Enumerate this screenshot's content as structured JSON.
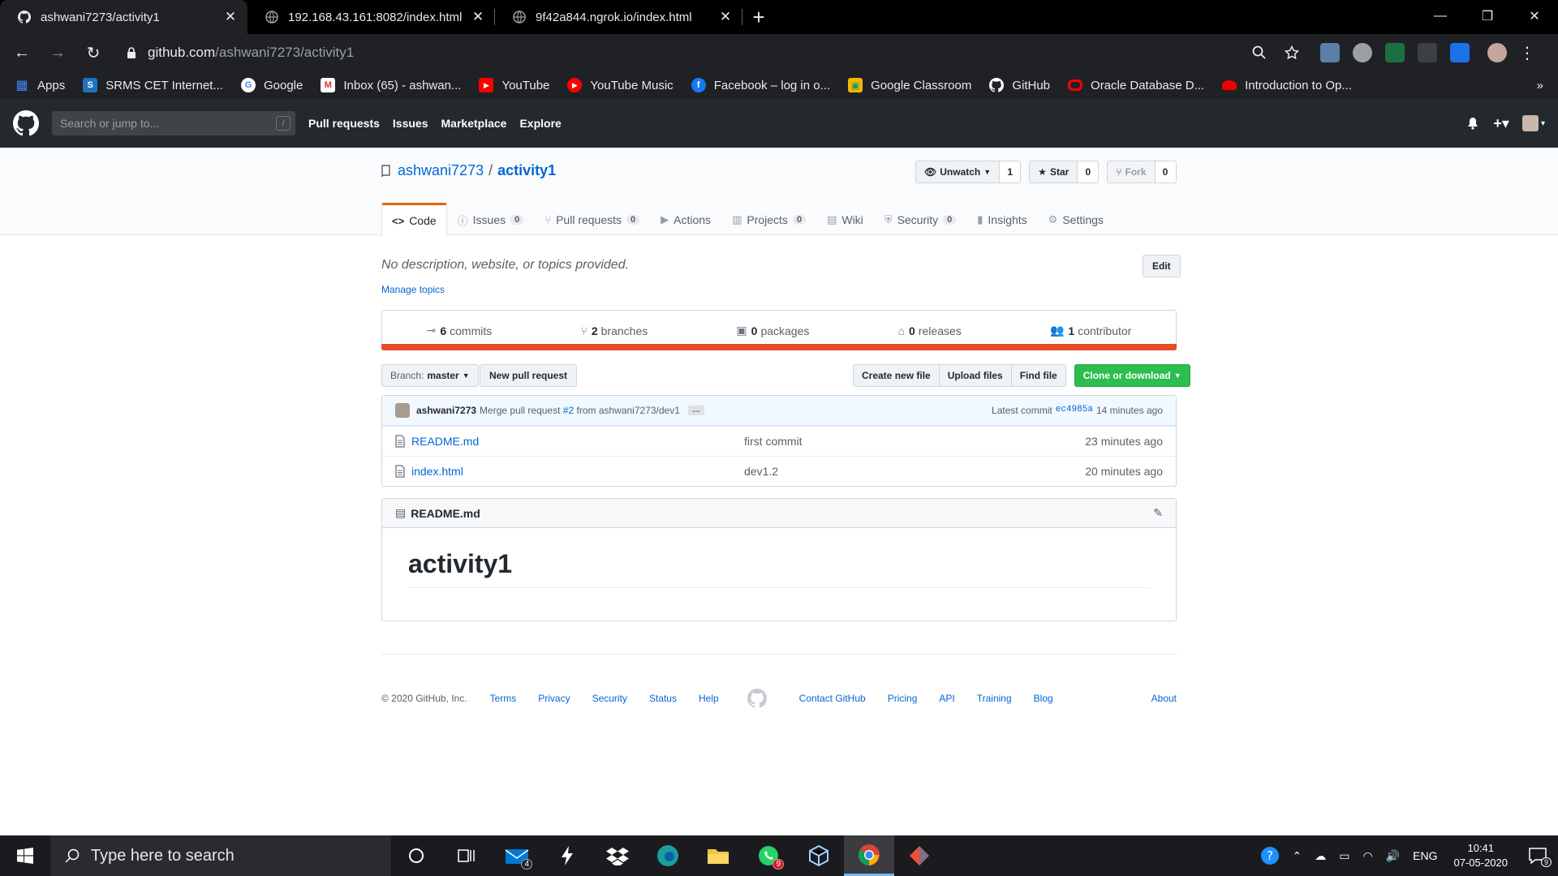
{
  "browser": {
    "tabs": [
      {
        "title": "ashwani7273/activity1",
        "active": true,
        "icon": "github-icon"
      },
      {
        "title": "192.168.43.161:8082/index.html",
        "active": false,
        "icon": "globe-icon"
      },
      {
        "title": "9f42a844.ngrok.io/index.html",
        "active": false,
        "icon": "globe-icon"
      }
    ],
    "new_tab_label": "+",
    "url_host": "github.com",
    "url_path": "/ashwani7273/activity1",
    "bookmarks": [
      {
        "label": "Apps",
        "icon": "apps-grid-icon",
        "color": "#4285f4"
      },
      {
        "label": "SRMS CET Internet...",
        "icon": "srms-icon",
        "color": "#1e73be"
      },
      {
        "label": "Google",
        "icon": "google-icon",
        "color": "#ea4335"
      },
      {
        "label": "Inbox (65) - ashwan...",
        "icon": "gmail-icon",
        "color": "#d93025"
      },
      {
        "label": "YouTube",
        "icon": "youtube-icon",
        "color": "#ff0000"
      },
      {
        "label": "YouTube Music",
        "icon": "youtube-music-icon",
        "color": "#ff0000"
      },
      {
        "label": "Facebook – log in o...",
        "icon": "facebook-icon",
        "color": "#1877f2"
      },
      {
        "label": "Google Classroom",
        "icon": "classroom-icon",
        "color": "#f4b400"
      },
      {
        "label": "GitHub",
        "icon": "github-icon",
        "color": "#ffffff"
      },
      {
        "label": "Oracle Database D...",
        "icon": "oracle-icon",
        "color": "#f80000"
      },
      {
        "label": "Introduction to Op...",
        "icon": "redhat-icon",
        "color": "#ee0000"
      }
    ],
    "more_bookmarks": "»"
  },
  "github": {
    "search_placeholder": "Search or jump to...",
    "search_key": "/",
    "nav": [
      "Pull requests",
      "Issues",
      "Marketplace",
      "Explore"
    ],
    "repo": {
      "owner": "ashwani7273",
      "separator": "/",
      "name": "activity1",
      "watch_label": "Unwatch",
      "watch_count": "1",
      "star_label": "Star",
      "star_count": "0",
      "fork_label": "Fork",
      "fork_count": "0"
    },
    "tabs": [
      {
        "label": "Code",
        "count": "",
        "icon": "code-icon",
        "selected": true
      },
      {
        "label": "Issues",
        "count": "0",
        "icon": "issue-icon"
      },
      {
        "label": "Pull requests",
        "count": "0",
        "icon": "pr-icon"
      },
      {
        "label": "Actions",
        "count": "",
        "icon": "play-icon"
      },
      {
        "label": "Projects",
        "count": "0",
        "icon": "project-icon"
      },
      {
        "label": "Wiki",
        "count": "",
        "icon": "book-icon"
      },
      {
        "label": "Security",
        "count": "0",
        "icon": "shield-icon"
      },
      {
        "label": "Insights",
        "count": "",
        "icon": "graph-icon"
      },
      {
        "label": "Settings",
        "count": "",
        "icon": "gear-icon"
      }
    ],
    "description": "No description, website, or topics provided.",
    "manage_topics": "Manage topics",
    "edit_label": "Edit",
    "summary": [
      {
        "num": "6",
        "label": "commits",
        "icon": "commit-icon"
      },
      {
        "num": "2",
        "label": "branches",
        "icon": "branch-icon"
      },
      {
        "num": "0",
        "label": "packages",
        "icon": "package-icon"
      },
      {
        "num": "0",
        "label": "releases",
        "icon": "tag-icon"
      },
      {
        "num": "1",
        "label": "contributor",
        "icon": "people-icon"
      }
    ],
    "language_color": "#e34c26",
    "branch_prefix": "Branch:",
    "branch_name": "master",
    "new_pr_label": "New pull request",
    "file_buttons": [
      "Create new file",
      "Upload files",
      "Find file"
    ],
    "clone_label": "Clone or download",
    "latest_commit": {
      "author": "ashwani7273",
      "message_pre": "Merge pull request",
      "pr": "#2",
      "message_post": "from ashwani7273/dev1",
      "ellipsis": "…",
      "latest_label": "Latest commit",
      "sha": "ec4985a",
      "age": "14 minutes ago"
    },
    "files": [
      {
        "name": "README.md",
        "message": "first commit",
        "age": "23 minutes ago"
      },
      {
        "name": "index.html",
        "message": "dev1.2",
        "age": "20 minutes ago"
      }
    ],
    "readme": {
      "filename": "README.md",
      "heading": "activity1"
    },
    "footer": {
      "copyright": "© 2020 GitHub, Inc.",
      "left_links": [
        "Terms",
        "Privacy",
        "Security",
        "Status",
        "Help"
      ],
      "right_links": [
        "Contact GitHub",
        "Pricing",
        "API",
        "Training",
        "Blog",
        "About"
      ]
    }
  },
  "taskbar": {
    "search_placeholder": "Type here to search",
    "apps": [
      {
        "name": "cortana-icon"
      },
      {
        "name": "task-view-icon"
      },
      {
        "name": "mail-icon",
        "badge": "4"
      },
      {
        "name": "bolt-app-icon"
      },
      {
        "name": "dropbox-icon"
      },
      {
        "name": "edge-icon"
      },
      {
        "name": "file-explorer-icon"
      },
      {
        "name": "whatsapp-icon",
        "badge": "9"
      },
      {
        "name": "virtualbox-icon"
      },
      {
        "name": "chrome-icon",
        "active": true
      },
      {
        "name": "git-icon"
      }
    ],
    "language": "ENG",
    "time": "10:41",
    "date": "07-05-2020",
    "notifications": "9"
  }
}
